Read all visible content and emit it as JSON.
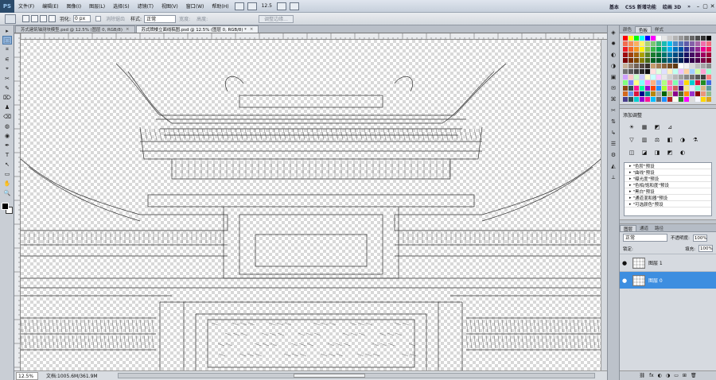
{
  "menubar": {
    "logo": "PS",
    "items": [
      "文件(F)",
      "编辑(E)",
      "图像(I)",
      "图层(L)",
      "选择(S)",
      "滤镜(T)",
      "视图(V)",
      "窗口(W)",
      "帮助(H)"
    ],
    "zoom": "12.5",
    "workspaces": [
      "基本",
      "CSS 新增功能",
      "绘画 3D"
    ],
    "more": "»",
    "win_buttons": [
      "–",
      "▢",
      "✕"
    ]
  },
  "options": {
    "feather_label": "羽化:",
    "feather_value": "0 px",
    "antialias": "消除锯齿",
    "style_label": "样式:",
    "style_value": "正常",
    "width_label": "宽度:",
    "height_label": "高度:",
    "refine_button": "调整边缘..."
  },
  "tools": [
    "▸",
    "⬚",
    "⌗",
    "⚟",
    "⌖",
    "✂",
    "✎",
    "⌦",
    "♟",
    "⌫",
    "◍",
    "◉",
    "✒",
    "T",
    "↖",
    "▭",
    "✋",
    "🔍"
  ],
  "document": {
    "tabs": [
      {
        "label": "苏式建筑轴测块模型.psd @ 12.5% (图层 0, RGB/8)",
        "active": false
      },
      {
        "label": "苏式牌楼立面线稿图.psd @ 12.5% (图层 0, RGB/8) *",
        "active": true
      }
    ],
    "close": "×",
    "zoom": "12.5%",
    "doc_info": "文档:1005.6M/361.9M"
  },
  "icon_strip": [
    "◈",
    "✹",
    "◐",
    "◑",
    "▣",
    "✉",
    "⌘",
    "✂",
    "⇅",
    "↳",
    "☰",
    "⚙",
    "◭",
    "⟂"
  ],
  "panels": {
    "swatch_tabs": [
      "颜色",
      "色板",
      "样式"
    ],
    "swatches": [
      "#ff0000",
      "#ffff00",
      "#00ff00",
      "#00ffff",
      "#0000ff",
      "#ff00ff",
      "#ffffff",
      "#e6e6e6",
      "#cccccc",
      "#b3b3b3",
      "#999999",
      "#808080",
      "#666666",
      "#4d4d4d",
      "#333333",
      "#000000",
      "#f26c4f",
      "#f68e55",
      "#fbaf5d",
      "#fff467",
      "#acd372",
      "#7cc576",
      "#3bb878",
      "#1abbb4",
      "#00bff3",
      "#438cca",
      "#5574b9",
      "#605ca8",
      "#855fa8",
      "#a763a8",
      "#f06ea9",
      "#f26d7d",
      "#ed1c24",
      "#f26522",
      "#f7941d",
      "#fff200",
      "#8dc73f",
      "#39b54a",
      "#00a651",
      "#00a99d",
      "#00aeef",
      "#0072bc",
      "#0054a6",
      "#2e3192",
      "#662d91",
      "#92278f",
      "#ec008c",
      "#ed145b",
      "#9e0b0f",
      "#a0410d",
      "#a36209",
      "#aba000",
      "#598527",
      "#1a7b30",
      "#007236",
      "#00746b",
      "#0076a3",
      "#004b80",
      "#003471",
      "#1b1464",
      "#440e62",
      "#630460",
      "#9e005d",
      "#9e0039",
      "#790000",
      "#7b2e00",
      "#7d4900",
      "#827b00",
      "#406618",
      "#005e20",
      "#005826",
      "#005952",
      "#005b7f",
      "#003663",
      "#002157",
      "#0d004c",
      "#32004b",
      "#4b0049",
      "#7b0046",
      "#7a0026",
      "#c7b299",
      "#998675",
      "#736357",
      "#534741",
      "#37302a",
      "#c69c6d",
      "#a67c52",
      "#8c6239",
      "#754c24",
      "#603913",
      "#ffffff",
      "#f2f2f2",
      "#d9d9d9",
      "#bfbfbf",
      "#a6a6a6",
      "#8c8c8c",
      "#737373",
      "#595959",
      "#404040",
      "#262626",
      "#0d0d0d",
      "#ffe0e0",
      "#e0ffe0",
      "#e0e0ff",
      "#fff0c0",
      "#c0fff0",
      "#f0c0ff",
      "#ffd0a0",
      "#a0d0ff",
      "#d0ffa0",
      "#ffa0d0",
      "#a0ffd0",
      "#d0a0ff",
      "#ffc8c8",
      "#c8ffc8",
      "#c8c8ff",
      "#ffffc8",
      "#c8ffff",
      "#ffc8ff",
      "#e8e8e8",
      "#d0d0d0",
      "#b8b8b8",
      "#a0a0a0",
      "#888888",
      "#707070",
      "#585858",
      "#404040",
      "#ff8080",
      "#80ff80",
      "#8080ff",
      "#ffff80",
      "#80ffff",
      "#ff80ff",
      "#ffb080",
      "#80b0ff",
      "#b0ff80",
      "#ff80b0",
      "#80ffb0",
      "#b080ff",
      "#ffd700",
      "#00ced1",
      "#dc143c",
      "#228b22",
      "#4169e1",
      "#8b4513",
      "#2f4f4f",
      "#ff1493",
      "#00fa9a",
      "#9400d3",
      "#ff4500",
      "#1e90ff",
      "#adff2f",
      "#ff69b4",
      "#cd5c5c",
      "#4b0082",
      "#f0e68c",
      "#e6e6fa",
      "#7fffd4",
      "#deb887",
      "#5f9ea0",
      "#d2691e",
      "#6495ed",
      "#dc143c",
      "#00008b",
      "#008b8b",
      "#b8860b",
      "#a9a9a9",
      "#006400",
      "#bdb76b",
      "#8b008b",
      "#556b2f",
      "#ff8c00",
      "#9932cc",
      "#8b0000",
      "#e9967a",
      "#8fbc8f",
      "#483d8b",
      "#2f4f4f",
      "#00ced1",
      "#9400d3",
      "#ff1493",
      "#00bfff",
      "#696969",
      "#1e90ff",
      "#b22222",
      "#fffaf0",
      "#228b22",
      "#ff00ff",
      "#dcdcdc",
      "#f8f8ff",
      "#ffd700",
      "#daa520",
      "#808080"
    ],
    "adjust_title": "添加调整",
    "adjust_icons": [
      "☀",
      "▦",
      "◩",
      "⊿",
      "▽",
      "▥",
      "⚖",
      "◧",
      "◑",
      "⚗",
      "◫",
      "◪",
      "◨",
      "◩",
      "◐"
    ],
    "presets": [
      "\"色阶\"预设",
      "\"曲线\"预设",
      "\"曝光度\"预设",
      "\"色相/饱和度\"预设",
      "\"黑白\"预设",
      "\"通道混和器\"预设",
      "\"可选颜色\"预设"
    ],
    "layer_tabs": [
      "图层",
      "通道",
      "路径"
    ],
    "blend_mode": "正常",
    "opacity_label": "不透明度:",
    "opacity": "100%",
    "lock_label": "锁定:",
    "fill_label": "填充:",
    "fill": "100%",
    "layers": [
      {
        "name": "图层 1",
        "selected": false
      },
      {
        "name": "图层 0",
        "selected": true
      }
    ],
    "footer_icons": [
      "⛓",
      "fx",
      "◐",
      "◑",
      "▭",
      "⊞",
      "🗑"
    ]
  }
}
